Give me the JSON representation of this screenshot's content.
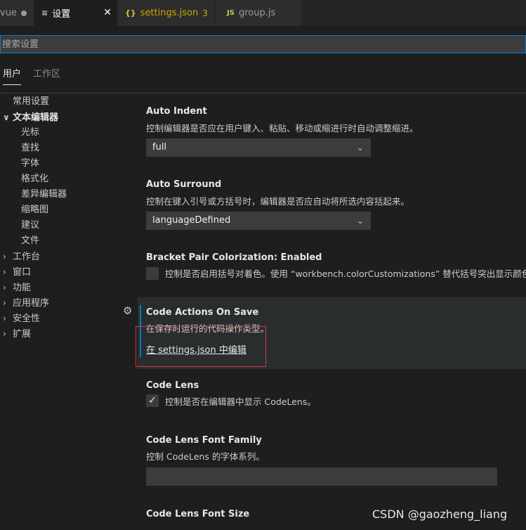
{
  "tabs": [
    {
      "label": "vue",
      "icon": "",
      "state": "dirty"
    },
    {
      "label": "设置",
      "icon": "≡",
      "state": "active"
    },
    {
      "label": "settings.json",
      "icon": "{}",
      "badge": "3"
    },
    {
      "label": "group.js",
      "icon": "JS"
    }
  ],
  "search": {
    "placeholder": "搜索设置"
  },
  "scope_tabs": {
    "user": "用户",
    "workspace": "工作区"
  },
  "toc": [
    {
      "label": "常用设置",
      "chevron": ""
    },
    {
      "label": "文本编辑器",
      "chevron": "∨"
    },
    {
      "label": "光标",
      "chevron": ""
    },
    {
      "label": "查找",
      "chevron": ""
    },
    {
      "label": "字体",
      "chevron": ""
    },
    {
      "label": "格式化",
      "chevron": ""
    },
    {
      "label": "差异编辑器",
      "chevron": ""
    },
    {
      "label": "缩略图",
      "chevron": ""
    },
    {
      "label": "建议",
      "chevron": ""
    },
    {
      "label": "文件",
      "chevron": ""
    },
    {
      "label": "工作台",
      "chevron": "›"
    },
    {
      "label": "窗口",
      "chevron": "›"
    },
    {
      "label": "功能",
      "chevron": "›"
    },
    {
      "label": "应用程序",
      "chevron": "›"
    },
    {
      "label": "安全性",
      "chevron": "›"
    },
    {
      "label": "扩展",
      "chevron": "›"
    }
  ],
  "settings": {
    "auto_indent": {
      "title": "Auto Indent",
      "desc": "控制编辑器是否应在用户键入、粘贴、移动或缩进行时自动调整缩进。",
      "value": "full"
    },
    "auto_surround": {
      "title": "Auto Surround",
      "desc": "控制在键入引号或方括号时，编辑器是否应自动将所选内容括起来。",
      "value": "languageDefined"
    },
    "bracket_pair": {
      "title": "Bracket Pair Colorization: ",
      "title_value": "Enabled",
      "desc": "控制是否启用括号对着色。使用 “workbench.colorCustomizations” 替代括号突出显示颜色。"
    },
    "code_actions": {
      "title": "Code Actions On Save",
      "desc": "在保存时运行的代码操作类型。",
      "link": "在 settings.json 中编辑"
    },
    "code_lens": {
      "title": "Code Lens",
      "desc": "控制是否在编辑器中显示 CodeLens。",
      "checked": true
    },
    "code_lens_font_family": {
      "title": "Code Lens Font Family",
      "desc": "控制 CodeLens 的字体系列。",
      "value": ""
    },
    "code_lens_font_size": {
      "title": "Code Lens Font Size"
    }
  },
  "icons": {
    "check": "✓",
    "chevron_down": "⌄",
    "gear": "⚙"
  },
  "watermark": "CSDN @gaozheng_liang",
  "colors": {
    "accent": "#007acc",
    "highlight": "#d9373b",
    "badge": "#cca700"
  }
}
